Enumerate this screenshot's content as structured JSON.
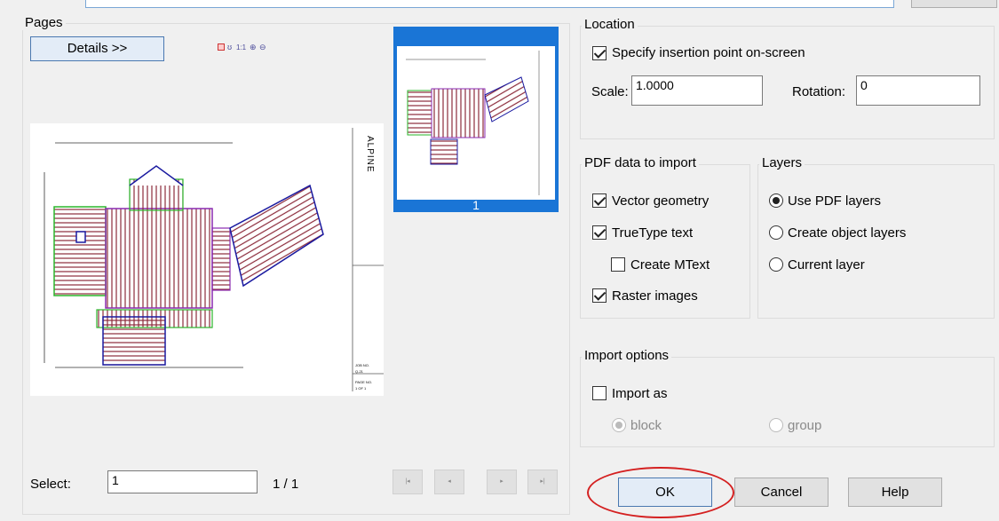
{
  "pages": {
    "title": "Pages",
    "details_button": "Details >>",
    "thumbnail_label": "1",
    "preview": {
      "logo": "ALPINE",
      "job_label": "JOB NO.",
      "job_value": "Q-21",
      "page_label": "PAGE NO.",
      "page_value": "1 OF 1"
    },
    "select_label": "Select:",
    "select_value": "1",
    "page_count": "1 / 1"
  },
  "location": {
    "title": "Location",
    "specify_label": "Specify insertion point on-screen",
    "specify_checked": true,
    "scale_label": "Scale:",
    "scale_value": "1.0000",
    "rotation_label": "Rotation:",
    "rotation_value": "0"
  },
  "pdf_data": {
    "title": "PDF data to import",
    "vector_label": "Vector geometry",
    "truetype_label": "TrueType text",
    "mtext_label": "Create MText",
    "raster_label": "Raster images"
  },
  "layers": {
    "title": "Layers",
    "use_pdf_label": "Use PDF layers",
    "create_object_label": "Create object layers",
    "current_label": "Current layer",
    "selected": "Use PDF layers"
  },
  "import_options": {
    "title": "Import options",
    "import_as_label": "Import as",
    "block_label": "block",
    "group_label": "group"
  },
  "buttons": {
    "ok": "OK",
    "cancel": "Cancel",
    "help": "Help"
  },
  "colors": {
    "highlight": "#1a75d6",
    "annotation": "#d42020"
  }
}
